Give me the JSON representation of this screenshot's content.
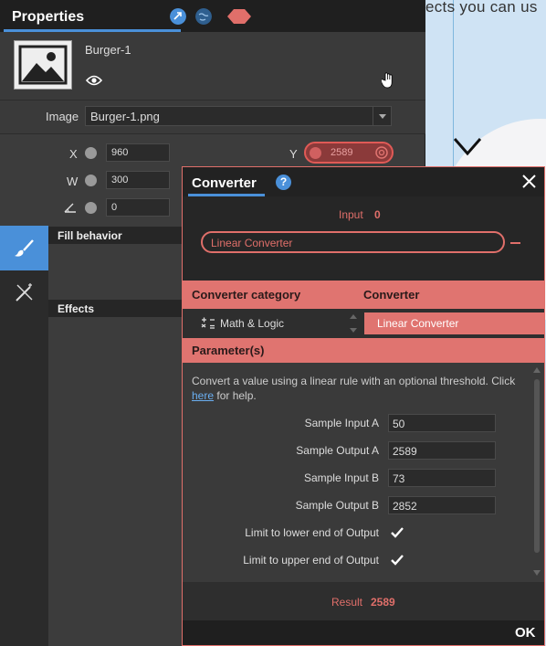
{
  "canvas": {
    "visible_text": "ects you can us"
  },
  "properties": {
    "title": "Properties",
    "object_name": "Burger-1",
    "image_label": "Image",
    "image_value": "Burger-1.png",
    "fields": {
      "x_label": "X",
      "x_value": "960",
      "y_label": "Y",
      "y_value": "2589",
      "w_label": "W",
      "w_value": "300",
      "angle_value": "0"
    },
    "sections": {
      "fill_behavior": "Fill behavior",
      "effects": "Effects"
    }
  },
  "converter": {
    "title": "Converter",
    "help_label": "?",
    "input_label": "Input",
    "input_value": "0",
    "selected_converter": "Linear Converter",
    "category_header": "Converter category",
    "converter_header": "Converter",
    "category_item": "Math & Logic",
    "converter_item": "Linear Converter",
    "params_header": "Parameter(s)",
    "description_before": "Convert a value using a linear rule with an optional threshold. Click ",
    "description_link": "here",
    "description_after": " for help.",
    "params": [
      {
        "label": "Sample Input A",
        "value": "50"
      },
      {
        "label": "Sample Output A",
        "value": "2589"
      },
      {
        "label": "Sample Input B",
        "value": "73"
      },
      {
        "label": "Sample Output B",
        "value": "2852"
      }
    ],
    "checks": [
      {
        "label": "Limit to lower end of Output",
        "checked": true
      },
      {
        "label": "Limit to upper end of Output",
        "checked": true
      }
    ],
    "result_label": "Result",
    "result_value": "2589",
    "ok_label": "OK"
  },
  "colors": {
    "accent": "#4a90d9",
    "converter": "#e07470",
    "panel": "#3c3c3c"
  }
}
